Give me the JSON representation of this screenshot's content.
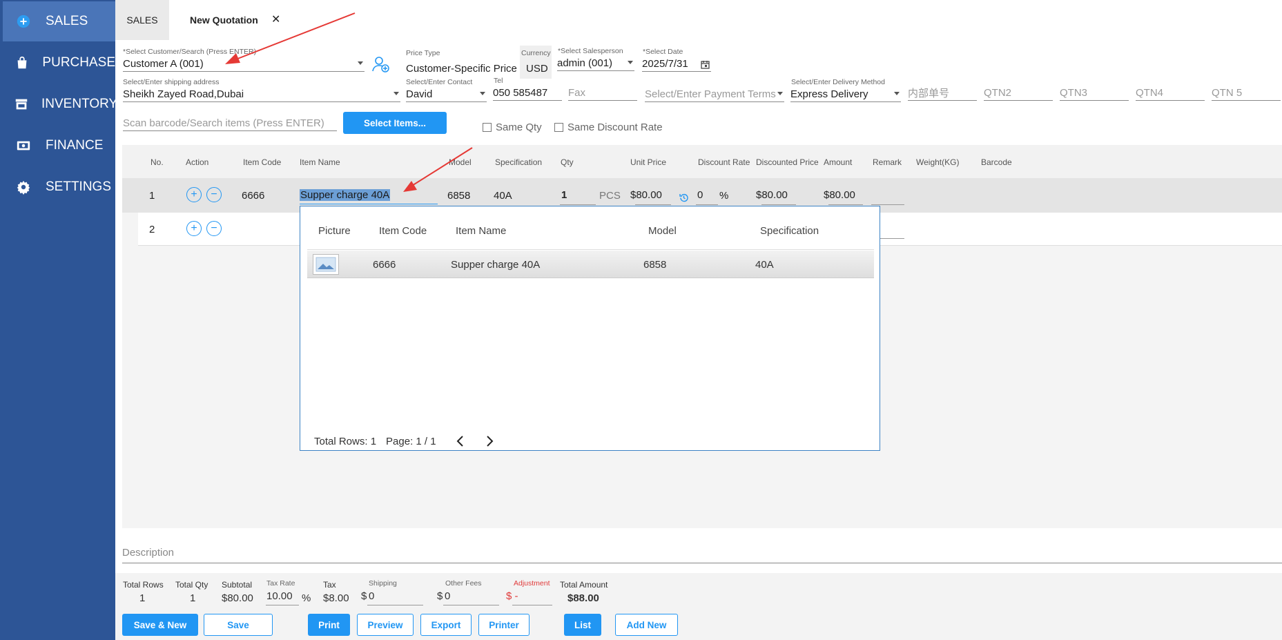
{
  "sidebar": {
    "items": [
      {
        "label": "SALES",
        "icon": "sales-icon"
      },
      {
        "label": "PURCHASE",
        "icon": "bag-icon"
      },
      {
        "label": "INVENTORY",
        "icon": "store-icon"
      },
      {
        "label": "FINANCE",
        "icon": "cash-icon"
      },
      {
        "label": "SETTINGS",
        "icon": "gear-icon"
      }
    ]
  },
  "tabs": {
    "sales": "SALES",
    "quotation": "New Quotation",
    "close": "✕"
  },
  "form": {
    "customer_label": "*Select Customer/Search (Press ENTER)",
    "customer_value": "Customer A (001)",
    "price_type_label": "Price Type",
    "price_type_value": "Customer-Specific Price",
    "currency_label": "Currency",
    "currency_value": "USD",
    "salesperson_label": "*Select Salesperson",
    "salesperson_value": "admin (001)",
    "date_label": "*Select Date",
    "date_value": "2025/7/31",
    "shipping_label": "Select/Enter shipping address",
    "shipping_value": "Sheikh Zayed Road,Dubai",
    "contact_label": "Select/Enter Contact",
    "contact_value": "David",
    "tel_label": "Tel",
    "tel_value": "050 585487",
    "fax_placeholder": "Fax",
    "payment_placeholder": "Select/Enter Payment Terms",
    "delivery_label": "Select/Enter Delivery Method",
    "delivery_value": "Express Delivery",
    "internal_no_placeholder": "内部单号",
    "qtn2": "QTN2",
    "qtn3": "QTN3",
    "qtn4": "QTN4",
    "qtn5": "QTN 5",
    "scan_placeholder": "Scan barcode/Search items (Press ENTER)",
    "select_items_button": "Select Items...",
    "same_qty": "Same Qty",
    "same_discount": "Same Discount Rate"
  },
  "grid": {
    "headers": [
      "No.",
      "Action",
      "Item Code",
      "Item Name",
      "Model",
      "Specification",
      "Qty",
      "Unit Price",
      "Discount Rate",
      "Discounted Price",
      "Amount",
      "Remark",
      "Weight(KG)",
      "Barcode"
    ],
    "rows": [
      {
        "no": "1",
        "item_code": "6666",
        "item_name": "Supper charge  40A",
        "model": "6858",
        "spec": "40A",
        "qty": "1",
        "unit": "PCS",
        "unit_price": "$80.00",
        "discount": "0",
        "pct": "%",
        "discounted_price": "$80.00",
        "amount": "$80.00"
      },
      {
        "no": "2"
      }
    ]
  },
  "popup": {
    "headers": [
      "Picture",
      "Item Code",
      "Item Name",
      "Model",
      "Specification"
    ],
    "rows": [
      {
        "item_code": "6666",
        "item_name": "Supper charge  40A",
        "model": "6858",
        "spec": "40A"
      }
    ],
    "total_rows": "Total Rows: 1",
    "page": "Page: 1 / 1"
  },
  "description_placeholder": "Description",
  "totals": {
    "total_rows_label": "Total Rows",
    "total_rows": "1",
    "total_qty_label": "Total Qty",
    "total_qty": "1",
    "subtotal_label": "Subtotal",
    "subtotal": "$80.00",
    "tax_rate_label": "Tax Rate",
    "tax_rate": "10.00",
    "pct": "%",
    "tax_label": "Tax",
    "tax": "$8.00",
    "shipping_label": "Shipping",
    "shipping_currency": "$",
    "shipping": "0",
    "other_fees_label": "Other Fees",
    "other_currency": "$",
    "other_fees": "0",
    "adjustment_label": "Adjustment",
    "adjustment": "$ -",
    "total_amount_label": "Total Amount",
    "total_amount": "$88.00"
  },
  "buttons": {
    "save_new": "Save & New",
    "save": "Save",
    "print": "Print",
    "preview": "Preview",
    "export": "Export",
    "printer": "Printer",
    "list": "List",
    "add_new": "Add New"
  },
  "colors": {
    "sidebar": "#2d5596",
    "accent": "#2196f3",
    "annotation_arrow": "#e53935"
  }
}
